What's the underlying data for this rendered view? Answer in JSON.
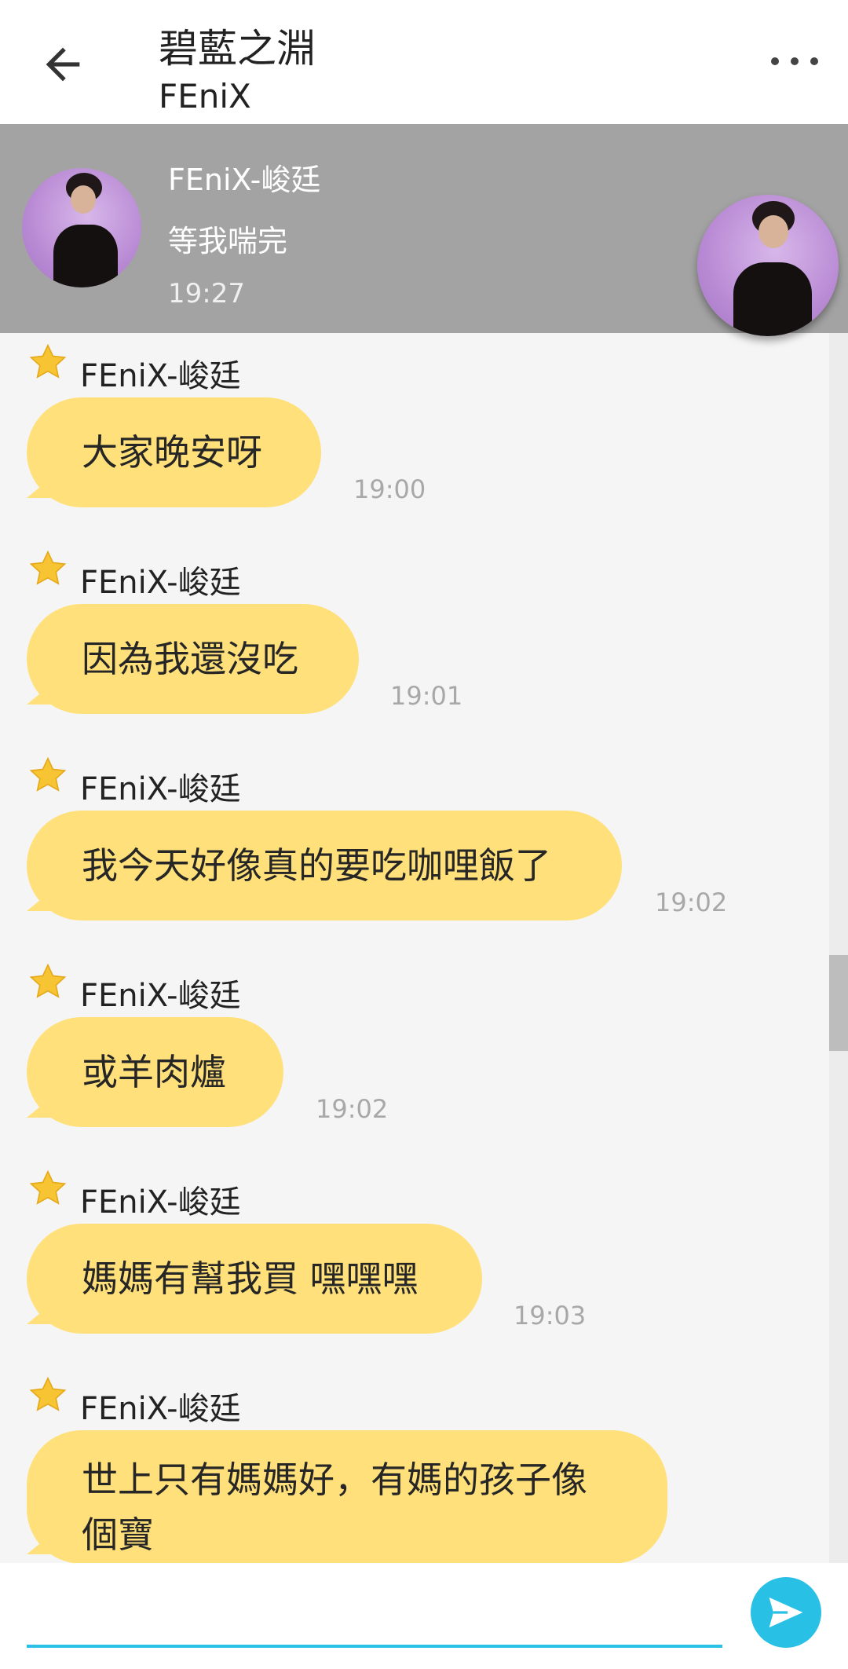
{
  "header": {
    "title": "碧藍之淵",
    "subtitle": "FEniX"
  },
  "pinned": {
    "name": "FEniX-峻廷",
    "message": "等我喘完",
    "time": "19:27"
  },
  "messages": [
    {
      "sender": "FEniX-峻廷",
      "text": "大家晚安呀",
      "time": "19:00"
    },
    {
      "sender": "FEniX-峻廷",
      "text": "因為我還沒吃",
      "time": "19:01"
    },
    {
      "sender": "FEniX-峻廷",
      "text": "我今天好像真的要吃咖哩飯了",
      "time": "19:02"
    },
    {
      "sender": "FEniX-峻廷",
      "text": "或羊肉爐",
      "time": "19:02"
    },
    {
      "sender": "FEniX-峻廷",
      "text": "媽媽有幫我買 嘿嘿嘿",
      "time": "19:03"
    },
    {
      "sender": "FEniX-峻廷",
      "text": "世上只有媽媽好，有媽的孩子像個寶",
      "time": ""
    }
  ],
  "input": {
    "placeholder": ""
  },
  "colors": {
    "bubble": "#ffe07a",
    "pinned_bg": "#a3a3a3",
    "accent": "#29c0e6",
    "timestamp": "#a8a8a8"
  },
  "icons": {
    "back": "arrow-left-icon",
    "more": "more-dots-icon",
    "badge": "star-icon",
    "send": "send-icon"
  }
}
